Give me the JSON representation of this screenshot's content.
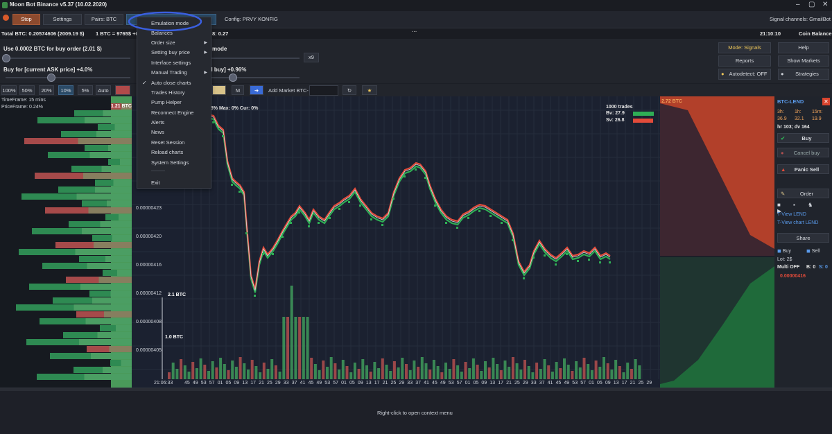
{
  "window": {
    "title": "Moon Bot Binance v5.37 (10.02.2020)",
    "minimize": "–",
    "restore": "▢",
    "close": "✕"
  },
  "toolbar": {
    "stop": "Stop",
    "settings": "Settings",
    "pairs": "Pairs: BTC",
    "config": "Config: PRVY KONFIG",
    "signal_channels": "Signal channels: GmailBot"
  },
  "infobar": {
    "total": "Total BTC: 0.20574606 (2009.19 $)",
    "rate": "1 BTC = 9765$ +0",
    "frag": "8: 0.27",
    "time": "21:10:10",
    "coin_balance": "Coin Balance"
  },
  "panel": {
    "use_order": "Use 0.0002 BTC for buy order  (2.01 $)",
    "buy_for": "Buy for [current ASK price] +4.0%",
    "mode_frag": "mode",
    "buy_frag": "al buy] +0.96%",
    "x9": "x9",
    "mode_signals": "Mode: Signals",
    "help": "Help",
    "reports": "Reports",
    "show_markets": "Show Markets",
    "autodetect": "Autodetect: OFF",
    "strategies": "Strategies"
  },
  "row2": {
    "pct": [
      "100%",
      "50%",
      "20%",
      "10%",
      "5%",
      "Auto"
    ],
    "m": "M",
    "add_market": "Add Market BTC-"
  },
  "menu": {
    "items": [
      {
        "label": "Emulation mode",
        "arrow": ""
      },
      {
        "label": "Balances",
        "arrow": ""
      },
      {
        "label": "Order size",
        "arrow": "▶"
      },
      {
        "label": "Setting buy price",
        "arrow": "▶"
      },
      {
        "label": "Interface settings",
        "arrow": ""
      },
      {
        "label": "Manual Trading",
        "arrow": "▶"
      },
      {
        "label": "Auto close charts",
        "arrow": ""
      },
      {
        "label": "Trades History",
        "arrow": ""
      },
      {
        "label": "Pump Helper",
        "arrow": ""
      },
      {
        "label": "Reconnect Engine",
        "arrow": ""
      },
      {
        "label": "Alerts",
        "arrow": ""
      },
      {
        "label": "News",
        "arrow": ""
      },
      {
        "label": "Reset Session",
        "arrow": ""
      },
      {
        "label": "Reload charts",
        "arrow": ""
      },
      {
        "label": "System Settings",
        "arrow": ""
      },
      {
        "label": "Exit",
        "arrow": ""
      }
    ],
    "check": "✓",
    "separator": "----------"
  },
  "left": {
    "timeframe": "TimeFrame: 15 mins",
    "pricerange": "PriceFrame: 0.24%",
    "vol": "1.21 BTC"
  },
  "chart": {
    "header": "s: 7.28%  Max: 0%  Cur: 0%",
    "trades_title": "1000 trades",
    "bv": "Bv: 27.9",
    "sv": "Sv: 26.8",
    "vol_2": "2.1 BTC",
    "vol_1": "1.0 BTC",
    "time_start": "21:06:33",
    "y_ticks": [
      "0.00000423",
      "0.00000420",
      "0.00000416",
      "0.00000412",
      "0.00000408",
      "0.00000405"
    ],
    "x_ticks": [
      "45",
      "49",
      "53",
      "57",
      "01",
      "05",
      "09",
      "13",
      "17",
      "21",
      "25",
      "29",
      "33",
      "37",
      "41",
      "45",
      "49",
      "53",
      "57",
      "01",
      "05",
      "09",
      "13",
      "17",
      "21",
      "25",
      "29",
      "33",
      "37",
      "41",
      "45",
      "49",
      "53",
      "57",
      "01",
      "05",
      "09",
      "13",
      "17",
      "21",
      "25",
      "29",
      "33",
      "37",
      "41",
      "45",
      "49",
      "53",
      "57",
      "01",
      "05",
      "09",
      "13",
      "17",
      "21",
      "25",
      "29"
    ]
  },
  "rightchart": {
    "label": "2.72 BTC"
  },
  "sidebar": {
    "pair": "BTC-LEND",
    "h": [
      "3h:",
      "1h:",
      "15m:"
    ],
    "v": [
      "36.9",
      "32.1",
      "19.9"
    ],
    "hr": "hr 103; dv 164",
    "buy": "Buy",
    "cancel_buy": "Cancel buy",
    "panic_sell": "Panic Sell",
    "order": "Order",
    "tview": "T-View LEND",
    "tview_chart": "T-View chart LEND",
    "share": "Share",
    "buy2": "Buy",
    "sell2": "Sell",
    "lot": "Lot: 2$",
    "multi": "Multi OFF",
    "b": "B: 0",
    "s": "S: 0",
    "price": "0.00000416"
  },
  "status": {
    "hint": "Right-click to open context menu"
  },
  "colors": {
    "green": "#2fae55",
    "red": "#e24b3a",
    "accent": "#3a6bd6"
  }
}
